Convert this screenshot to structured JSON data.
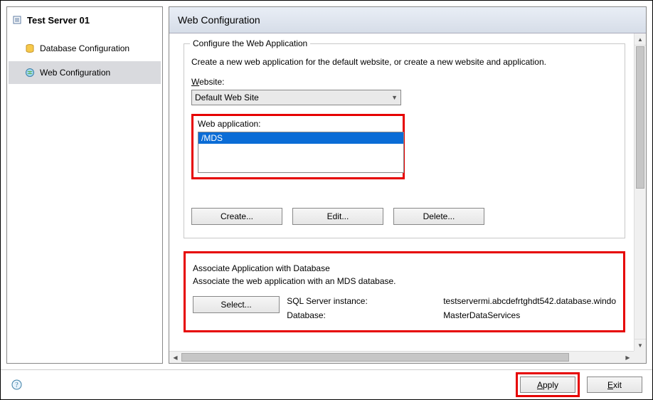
{
  "nav": {
    "title": "Test Server 01",
    "items": [
      {
        "label": "Database Configuration"
      },
      {
        "label": "Web Configuration"
      }
    ]
  },
  "content": {
    "header": "Web Configuration",
    "webapp_group": {
      "title": "Configure the Web Application",
      "desc": "Create a new web application for the default website, or create a new website and application.",
      "website_label_pre": "W",
      "website_label_post": "ebsite:",
      "website_value": "Default Web Site",
      "webapp_label": "Web application:",
      "webapp_selected": "/MDS",
      "buttons": {
        "create": "Create...",
        "edit": "Edit...",
        "delete": "Delete..."
      }
    },
    "assoc_group": {
      "title": "Associate Application with Database",
      "desc": "Associate the web application with an MDS database.",
      "select_label": "Select...",
      "sql_label": "SQL Server instance:",
      "sql_value": "testservermi.abcdefrtghdt542.database.windo",
      "db_label": "Database:",
      "db_value": "MasterDataServices"
    }
  },
  "footer": {
    "apply_pre": "A",
    "apply_post": "pply",
    "exit_pre": "E",
    "exit_post": "xit"
  }
}
